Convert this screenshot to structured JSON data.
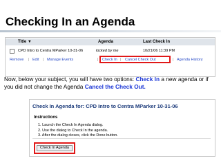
{
  "slide": {
    "title": "Checking In an Agenda",
    "explanation": {
      "part1": "Now, below your subject, you will have two options: ",
      "check_in": "Check In",
      "part2": " a new agenda or if you did not change the Agenda ",
      "cancel": "Cancel the Check Out."
    }
  },
  "table": {
    "headers": {
      "title": "Title ▼",
      "agenda": "Agenda",
      "last_check_in": "Last Check In"
    },
    "row": {
      "name": "CPD Intro to Centra MParker 10-31-06",
      "locked_by": "locked by me",
      "date": "10/21/06 11:39 PM"
    },
    "actions": [
      "Remove",
      "Edit",
      "Manage Events",
      "Check In",
      "Cancel Check Out",
      "Agenda History"
    ],
    "separator": "|"
  },
  "dialog": {
    "title": "Check In Agenda for: CPD Intro to Centra MParker 10-31-06",
    "instructions_heading": "Instructions",
    "steps": [
      "1.  Launch the Check In Agenda dialog.",
      "2.  Use the dialog to Check In the agenda.",
      "3.  After the dialog closes, click the Done button."
    ],
    "button_label": "Check In Agenda"
  },
  "colors": {
    "highlight": "#e01818",
    "keyword": "#1a35d6",
    "link": "#2a4cc7"
  }
}
